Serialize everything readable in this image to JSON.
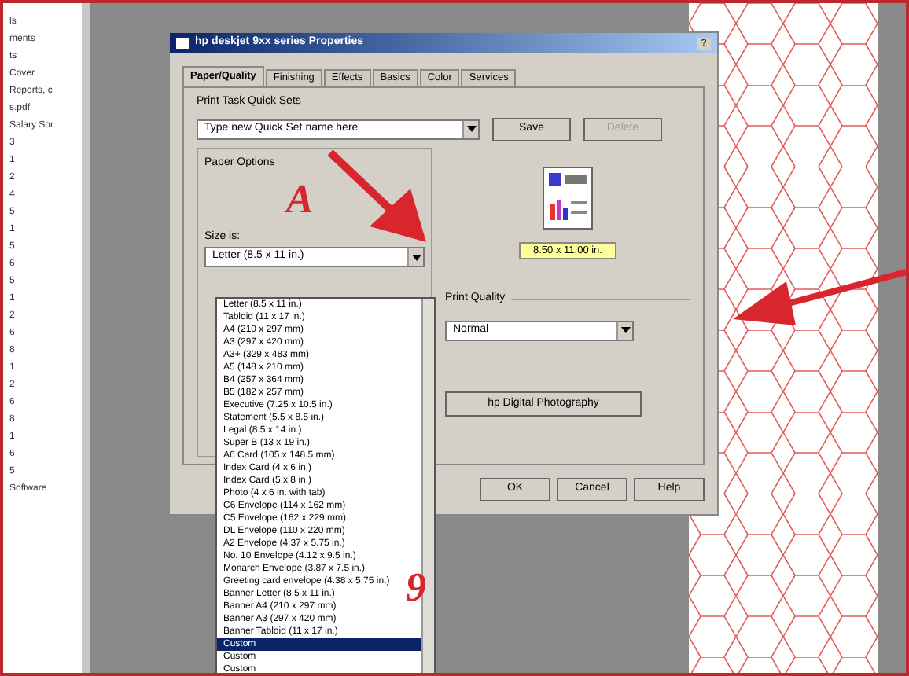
{
  "side_list": [
    "ls",
    "ments",
    "ts",
    "Cover",
    "Reports, c",
    "s.pdf",
    "Salary Sor",
    "3",
    "1",
    "2",
    "4",
    "5",
    "1",
    "5",
    "6",
    "5",
    "1",
    "2",
    "6",
    "8",
    "1",
    "2",
    "6",
    "8",
    "1",
    "6",
    "5",
    "Software"
  ],
  "dialog": {
    "title": "hp deskjet 9xx series Properties",
    "help_glyph": "?",
    "tabs": [
      {
        "label": "Paper/Quality",
        "selected": true
      },
      {
        "label": "Finishing",
        "selected": false
      },
      {
        "label": "Effects",
        "selected": false
      },
      {
        "label": "Basics",
        "selected": false
      },
      {
        "label": "Color",
        "selected": false
      },
      {
        "label": "Services",
        "selected": false
      }
    ],
    "quick_sets": {
      "label": "Print Task Quick Sets",
      "value": "Type new Quick Set name here",
      "buttons": [
        {
          "label": "Save",
          "disabled": false
        },
        {
          "label": "Delete",
          "disabled": true
        }
      ]
    },
    "paper_options": {
      "label": "Paper Options",
      "size_label": "Size is:",
      "size_value": "Letter (8.5 x 11 in.)"
    },
    "preview_size": "8.50 x 11.00 in.",
    "print_quality": {
      "label": "Print Quality",
      "value": "Normal"
    },
    "photo_button": "hp Digital Photography",
    "buttons": [
      "OK",
      "Cancel",
      "Help"
    ]
  },
  "size_list": [
    {
      "label": "Letter (8.5 x 11 in.)",
      "selected": false
    },
    {
      "label": "Tabloid (11 x 17 in.)",
      "selected": false
    },
    {
      "label": "A4 (210 x 297 mm)",
      "selected": false
    },
    {
      "label": "A3 (297 x 420 mm)",
      "selected": false
    },
    {
      "label": "A3+ (329 x 483 mm)",
      "selected": false
    },
    {
      "label": "A5 (148 x 210 mm)",
      "selected": false
    },
    {
      "label": "B4 (257 x 364 mm)",
      "selected": false
    },
    {
      "label": "B5 (182 x 257 mm)",
      "selected": false
    },
    {
      "label": "Executive (7.25 x 10.5 in.)",
      "selected": false
    },
    {
      "label": "Statement (5.5 x 8.5 in.)",
      "selected": false
    },
    {
      "label": "Legal (8.5 x 14 in.)",
      "selected": false
    },
    {
      "label": "Super B (13 x 19 in.)",
      "selected": false
    },
    {
      "label": "A6 Card (105 x 148.5 mm)",
      "selected": false
    },
    {
      "label": "Index Card (4 x 6 in.)",
      "selected": false
    },
    {
      "label": "Index Card (5 x 8 in.)",
      "selected": false
    },
    {
      "label": "Photo (4 x 6 in. with tab)",
      "selected": false
    },
    {
      "label": "C6 Envelope (114 x 162 mm)",
      "selected": false
    },
    {
      "label": "C5 Envelope (162 x 229 mm)",
      "selected": false
    },
    {
      "label": "DL Envelope (110 x 220 mm)",
      "selected": false
    },
    {
      "label": "A2 Envelope (4.37 x 5.75 in.)",
      "selected": false
    },
    {
      "label": "No. 10 Envelope (4.12 x 9.5 in.)",
      "selected": false
    },
    {
      "label": "Monarch Envelope (3.87 x 7.5 in.)",
      "selected": false
    },
    {
      "label": "Greeting card envelope (4.38 x 5.75 in.)",
      "selected": false
    },
    {
      "label": "Banner Letter (8.5 x 11 in.)",
      "selected": false
    },
    {
      "label": "Banner A4 (210 x 297 mm)",
      "selected": false
    },
    {
      "label": "Banner A3 (297 x 420 mm)",
      "selected": false
    },
    {
      "label": "Banner Tabloid (11 x 17 in.)",
      "selected": false
    },
    {
      "label": "Custom",
      "selected": true
    },
    {
      "label": "Custom",
      "selected": false
    },
    {
      "label": "Custom",
      "selected": false
    }
  ],
  "annotations": [
    "A",
    "9"
  ]
}
